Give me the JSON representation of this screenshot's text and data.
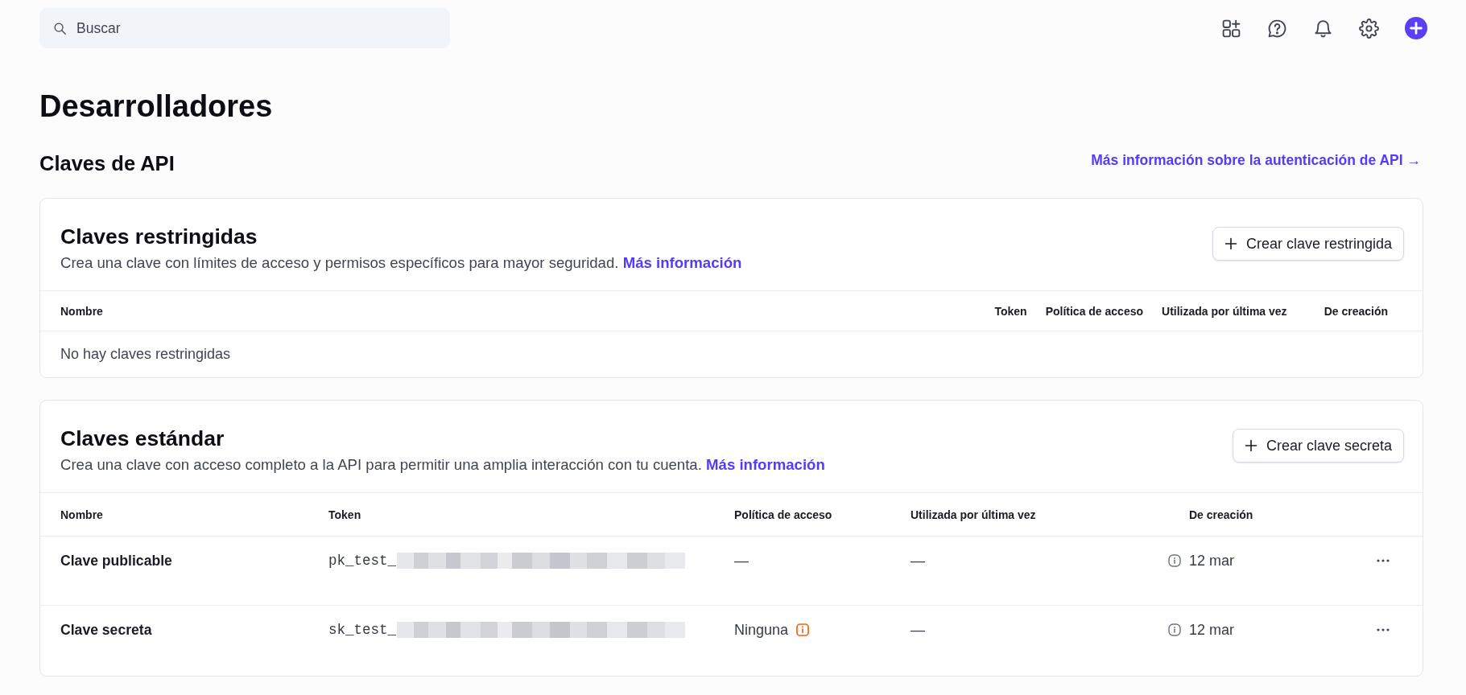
{
  "search": {
    "placeholder": "Buscar"
  },
  "page": {
    "title": "Desarrolladores"
  },
  "section": {
    "title": "Claves de API",
    "link": "Más información sobre la autenticación de API →"
  },
  "cards": [
    {
      "title": "Claves restringidas",
      "description": "Crea una clave con límites de acceso y permisos específicos para mayor seguridad.",
      "link": "Más información",
      "button": "Crear clave restringida",
      "columns": [
        "Nombre",
        "Token",
        "Política de acceso",
        "Utilizada por última vez",
        "De creación"
      ],
      "empty_message": "No hay claves restringidas"
    },
    {
      "title": "Claves estándar",
      "description": "Crea una clave con acceso completo a la API para permitir una amplia interacción con tu cuenta.",
      "link": "Más información",
      "button": "Crear clave secreta",
      "columns": [
        "Nombre",
        "Token",
        "Política de acceso",
        "Utilizada por última vez",
        "De creación"
      ],
      "rows": [
        {
          "name": "Clave publicable",
          "token": "pk_test_",
          "policy": "—",
          "warning": false,
          "last_used": "—",
          "created": "12 mar"
        },
        {
          "name": "Clave secreta",
          "token": "sk_test_",
          "policy": "Ninguna",
          "warning": true,
          "last_used": "—",
          "created": "12 mar"
        }
      ]
    }
  ]
}
